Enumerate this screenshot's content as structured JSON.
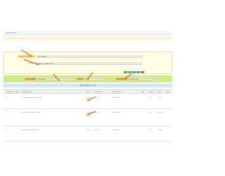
{
  "title_bar": {
    "label": "Price update tool"
  },
  "filter_panel": {
    "product_label": "Product Category",
    "product_value": "All Products",
    "name_label": "Product Name",
    "name_value": "Search product name"
  },
  "action_buttons": [
    "#6cb05c",
    "#6cb05c",
    "#4aa0d8",
    "#4aa0d8",
    "#e55c4d"
  ],
  "price_filters": {
    "type_label": "Price changes",
    "type_value": "Percentage",
    "amount_label": "Amount",
    "amount_value": "12.50",
    "mode_label": "Apply changes",
    "mode_value": "Increase price"
  },
  "tab_label": "Price Brand : 15",
  "table": {
    "headers": [
      "Product ID",
      "Image",
      "Product Name",
      "Price",
      "Wholesale",
      "Price",
      "Wholesale",
      "Specific Price",
      "Qty",
      "Active",
      "Stock",
      "Stock"
    ],
    "rows": [
      {
        "id": "15",
        "name": "Printed Summer Dress - Orange",
        "price": "$28.98",
        "price_new": "$30.50",
        "wholesale": "$9.78",
        "specific": "Discount 5%",
        "active": "Yes",
        "stock": "In stock"
      },
      {
        "id": "16",
        "name": "Printed Chiffon Dress - Yellow",
        "price": "$16.40",
        "price_new": "$18.45",
        "wholesale": "$4.92",
        "specific": "Discount 20%",
        "active": "Yes",
        "stock": "In stock"
      },
      {
        "id": "17",
        "name": "Faded Short Sleeves T-shirt",
        "price": "$16.51",
        "price_new": "$18.57",
        "wholesale": "$5.10",
        "specific": "Discount 5%",
        "active": "Yes",
        "stock": "In stock"
      }
    ]
  },
  "annotation_arrow_color": "#e0431c"
}
